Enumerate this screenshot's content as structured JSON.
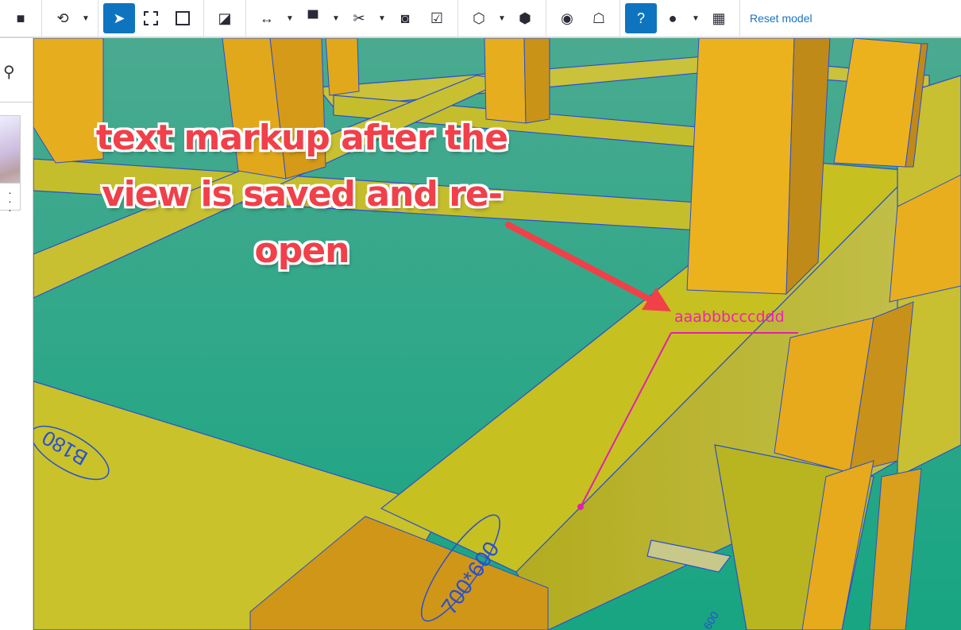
{
  "toolbar": {
    "items": [
      "folder-icon",
      "orbit-icon",
      "select-icon",
      "box-select-icon",
      "fit-icon",
      "exposure-icon",
      "measure-icon",
      "paint-icon",
      "cut-icon",
      "snapshot-icon",
      "checklist-icon",
      "cube-icon",
      "cube-solid-icon",
      "view-icon",
      "ghost-icon",
      "help-icon",
      "eye-icon",
      "texture-icon"
    ],
    "reset_label": "Reset model"
  },
  "annotation": {
    "lines": [
      "text markup after the",
      "view is saved and re-",
      "open"
    ]
  },
  "markup": {
    "text": "aaabbbcccddd",
    "color": "#e020b0"
  },
  "model_labels": [
    "B180",
    "700*600",
    "600"
  ]
}
